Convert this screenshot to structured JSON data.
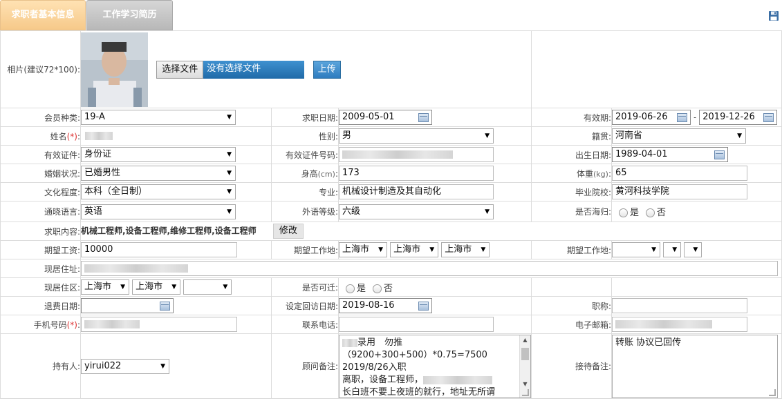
{
  "tabs": {
    "basic": "求职者基本信息",
    "work": "工作学习简历"
  },
  "photo": {
    "label": "相片(建议72*100):",
    "choose_btn": "选择文件",
    "file_status": "没有选择文件",
    "upload_btn": "上传"
  },
  "member_type": {
    "label": "会员种类:",
    "value": "19-A"
  },
  "apply_date": {
    "label": "求职日期:",
    "value": "2009-05-01"
  },
  "valid_period": {
    "label": "有效期:",
    "start": "2019-06-26",
    "sep": "-",
    "end": "2019-12-26"
  },
  "name": {
    "label": "姓名",
    "req": "(*)",
    "colon": ":"
  },
  "gender": {
    "label": "性别:",
    "value": "男"
  },
  "native_place": {
    "label": "籍贯:",
    "value": "河南省"
  },
  "id_type": {
    "label": "有效证件:",
    "value": "身份证"
  },
  "id_number": {
    "label": "有效证件号码:"
  },
  "birth_date": {
    "label": "出生日期:",
    "value": "1989-04-01"
  },
  "marital": {
    "label": "婚姻状况:",
    "value": "已婚男性"
  },
  "height": {
    "label": "身高",
    "unit": "(cm)",
    "colon": ":",
    "value": "173"
  },
  "weight": {
    "label": "体重",
    "unit": "(kg)",
    "colon": ":",
    "value": "65"
  },
  "education": {
    "label": "文化程度:",
    "value": "本科（全日制）"
  },
  "major": {
    "label": "专业:",
    "value": "机械设计制造及其自动化"
  },
  "school": {
    "label": "毕业院校:",
    "value": "黄河科技学院"
  },
  "language": {
    "label": "通晓语言:",
    "value": "英语"
  },
  "lang_level": {
    "label": "外语等级:",
    "value": "六级"
  },
  "overseas": {
    "label": "是否海归:",
    "yes": "是",
    "no": "否"
  },
  "job_content": {
    "label": "求职内容:",
    "value": "机械工程师,设备工程师,维修工程师,设备工程师",
    "edit_btn": "修改"
  },
  "salary": {
    "label": "期望工资:",
    "value": "10000"
  },
  "expect_location1": {
    "label": "期望工作地:",
    "province": "上海市",
    "city": "上海市",
    "district": "上海市"
  },
  "expect_location2": {
    "label": "期望工作地:"
  },
  "address": {
    "label": "现居住址:"
  },
  "residence": {
    "label": "现居住区:",
    "province": "上海市",
    "city": "上海市"
  },
  "relocate": {
    "label": "是否可迁:",
    "yes": "是",
    "no": "否"
  },
  "refund_date": {
    "label": "退费日期:"
  },
  "callback_date": {
    "label": "设定回访日期:",
    "value": "2019-08-16"
  },
  "title": {
    "label": "职称:"
  },
  "mobile": {
    "label": "手机号码",
    "req": "(*)",
    "colon": ":"
  },
  "phone": {
    "label": "联系电话:"
  },
  "email": {
    "label": "电子邮箱:"
  },
  "holder": {
    "label": "持有人:",
    "value": "yirui022"
  },
  "consultant_note": {
    "label": "顾问备注:",
    "line1": "录用　勿推",
    "line2": "（9200+300+500）*0.75=7500",
    "line3": "2019/8/26入职",
    "line4": "离职，设备工程师，",
    "line5": "长白班不要上夜班的就行，地址无所谓"
  },
  "reception_note": {
    "label": "接待备注:",
    "value": "转账 协议已回传"
  }
}
